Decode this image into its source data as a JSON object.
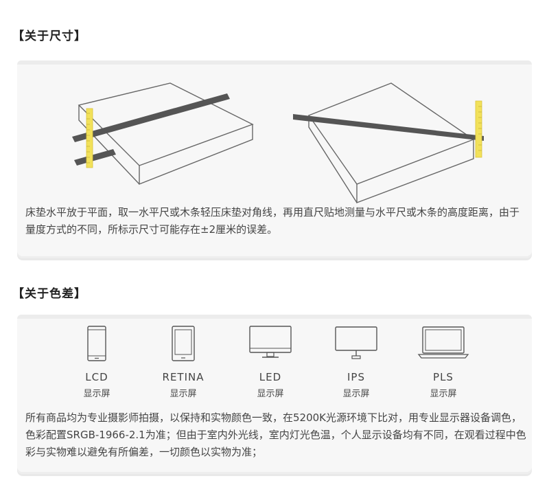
{
  "size_section": {
    "heading": "【关于尺寸】",
    "description": "床垫水平放于平面，取一水平尺或木条轻压床垫对角线，再用直尺贴地测量与水平尺或木条的高度距离，由于量度方式的不同，所标示尺寸可能存在±2厘米的误差。"
  },
  "color_section": {
    "heading": "【关于色差】",
    "devices": [
      {
        "name": "LCD",
        "sub": "显示屏",
        "icon": "phone-icon"
      },
      {
        "name": "RETINA",
        "sub": "显示屏",
        "icon": "tablet-icon"
      },
      {
        "name": "LED",
        "sub": "显示屏",
        "icon": "monitor-icon"
      },
      {
        "name": "IPS",
        "sub": "显示屏",
        "icon": "monitor-stand-icon"
      },
      {
        "name": "PLS",
        "sub": "显示屏",
        "icon": "laptop-icon"
      }
    ],
    "description": "所有商品均为专业摄影师拍摄，以保持和实物颜色一致，在5200K光源环境下比对，用专业显示器设备调色，色彩配置SRGB-1966-2.1为准；但由于室内外光线，室内灯光色温，个人显示设备均有不同，在观看过程中色彩与实物难以避免有所偏差，一切颜色以实物为准；"
  },
  "colors": {
    "ruler_yellow": "#f2e15a",
    "bar_dark": "#555555",
    "line": "#666666"
  }
}
